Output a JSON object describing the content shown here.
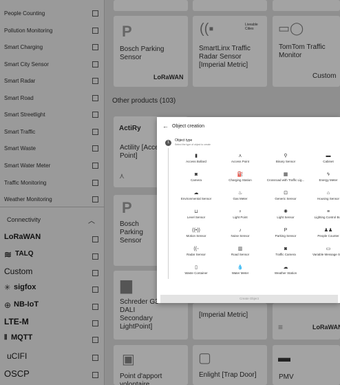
{
  "sidebar": {
    "filters": [
      {
        "label": "People Counting"
      },
      {
        "label": "Pollution Monitoring"
      },
      {
        "label": "Smart Charging"
      },
      {
        "label": "Smart City Sensor"
      },
      {
        "label": "Smart Radar"
      },
      {
        "label": "Smart Road"
      },
      {
        "label": "Smart Streetlight"
      },
      {
        "label": "Smart Traffic"
      },
      {
        "label": "Smart Waste"
      },
      {
        "label": "Smart Water Meter"
      },
      {
        "label": "Traffic Monitoring"
      },
      {
        "label": "Weather Monitoring"
      }
    ],
    "connectivity_title": "Connectivity",
    "connectivity": [
      {
        "label": "LoRaWAN"
      },
      {
        "label": "TALQ"
      },
      {
        "label": "Custom"
      },
      {
        "label": "sigfox"
      },
      {
        "label": "NB-IoT"
      },
      {
        "label": "LTE-M"
      },
      {
        "label": "MQTT"
      },
      {
        "label": "uCIFI"
      },
      {
        "label": "OSCP"
      }
    ]
  },
  "main": {
    "section_title": "Other products (103)",
    "cards": [
      {
        "name": "Bosch Parking Sensor",
        "badge": "LoRaWAN"
      },
      {
        "name": "SmartLinx Traffic Radar Sensor [Imperial Metric]",
        "badge": "Liveable Cities"
      },
      {
        "name": "TomTom Traffic Monitor",
        "badge": "Custom"
      },
      {
        "name": "Actility [Access Point]",
        "badge": "ActiRy"
      },
      {
        "name": "Bosch Parking Sensor",
        "badge": ""
      },
      {
        "name": "Schreder G3 DALI Secondary LightPoint]",
        "badge": ""
      },
      {
        "name": "[Imperial Metric]",
        "badge": ""
      },
      {
        "name": "Point d'apport volontaire",
        "badge": ""
      },
      {
        "name": "Enlight [Trap Door]",
        "badge": ""
      },
      {
        "name": "PMV",
        "badge": "LoRaWAN"
      }
    ]
  },
  "modal": {
    "title": "Object creation",
    "step_number": "1",
    "step_title": "Object type",
    "step_subtitle": "Select the type of object to create",
    "create_label": "Create Object",
    "types": [
      {
        "label": "Access Bollard",
        "icon": "bollard-icon",
        "glyph": "▮"
      },
      {
        "label": "Access Point",
        "icon": "access-point-icon",
        "glyph": "⋏"
      },
      {
        "label": "Binary Sensor",
        "icon": "binary-sensor-icon",
        "glyph": "⚲"
      },
      {
        "label": "Cabinet",
        "icon": "cabinet-icon",
        "glyph": "▬"
      },
      {
        "label": "Camera",
        "icon": "camera-icon",
        "glyph": "◙"
      },
      {
        "label": "Charging Station",
        "icon": "charging-station-icon",
        "glyph": "⛽"
      },
      {
        "label": "Crossroad with Traffic Lig...",
        "icon": "traffic-light-icon",
        "glyph": "▦"
      },
      {
        "label": "Energy Meter",
        "icon": "energy-meter-icon",
        "glyph": "ϟ"
      },
      {
        "label": "Environmental Sensor",
        "icon": "environmental-sensor-icon",
        "glyph": "☁"
      },
      {
        "label": "Gas Meter",
        "icon": "gas-meter-icon",
        "glyph": "♨"
      },
      {
        "label": "Generic Sensor",
        "icon": "generic-sensor-icon",
        "glyph": "⊡"
      },
      {
        "label": "Housing Sensor",
        "icon": "housing-sensor-icon",
        "glyph": "⌂"
      },
      {
        "label": "Level Sensor",
        "icon": "level-sensor-icon",
        "glyph": "⊔"
      },
      {
        "label": "Light Point",
        "icon": "light-point-icon",
        "glyph": "♀"
      },
      {
        "label": "Light Sensor",
        "icon": "light-sensor-icon",
        "glyph": "✺"
      },
      {
        "label": "Lighting Control Box",
        "icon": "lighting-control-icon",
        "glyph": "≡"
      },
      {
        "label": "Motion Sensor",
        "icon": "motion-sensor-icon",
        "glyph": "((•))"
      },
      {
        "label": "Noise Sensor",
        "icon": "noise-sensor-icon",
        "glyph": "♪"
      },
      {
        "label": "Parking Sensor",
        "icon": "parking-sensor-icon",
        "glyph": "P"
      },
      {
        "label": "People Counter",
        "icon": "people-counter-icon",
        "glyph": "♟♟"
      },
      {
        "label": "Radar Sensor",
        "icon": "radar-sensor-icon",
        "glyph": "((◦"
      },
      {
        "label": "Road Sensor",
        "icon": "road-sensor-icon",
        "glyph": "▥"
      },
      {
        "label": "Traffic Camera",
        "icon": "traffic-camera-icon",
        "glyph": "◙"
      },
      {
        "label": "Variable Message Sign",
        "icon": "message-sign-icon",
        "glyph": "▭"
      },
      {
        "label": "Waste Container",
        "icon": "waste-container-icon",
        "glyph": "▯"
      },
      {
        "label": "Water Meter",
        "icon": "water-meter-icon",
        "glyph": "💧"
      },
      {
        "label": "Weather Station",
        "icon": "weather-station-icon",
        "glyph": "☁"
      }
    ]
  }
}
